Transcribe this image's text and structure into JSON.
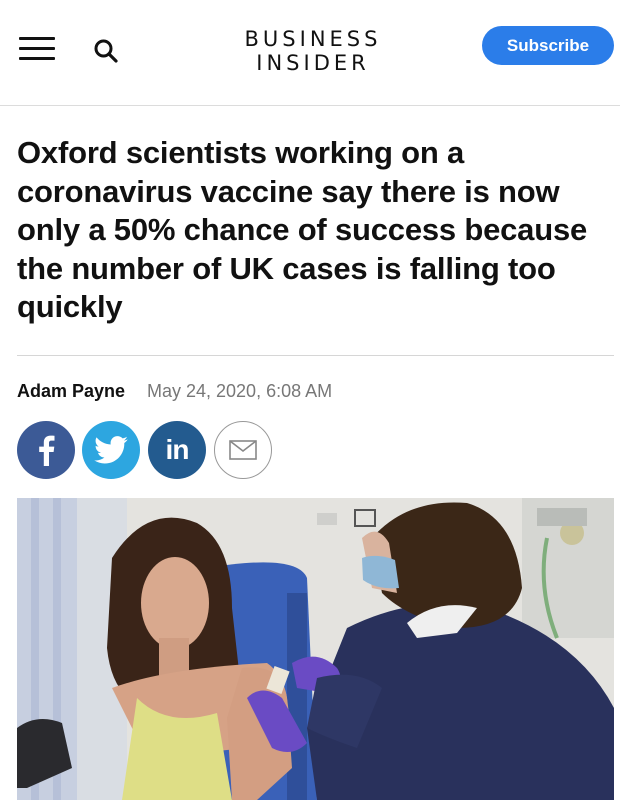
{
  "header": {
    "logo_line1": "BUSINESS",
    "logo_line2": "INSIDER",
    "subscribe_label": "Subscribe",
    "accent_color": "#2b7de9"
  },
  "icons": {
    "menu": "hamburger-menu-icon",
    "search": "search-icon",
    "facebook": "facebook-icon",
    "twitter": "twitter-icon",
    "linkedin": "linkedin-icon",
    "email": "email-icon"
  },
  "article": {
    "headline": "Oxford scientists working on a coronavirus vaccine say there is now only a 50% chance of success because the number of UK cases is falling too quickly",
    "author": "Adam Payne",
    "date": "May 24, 2020, 6:08 AM"
  },
  "share_colors": {
    "facebook": "#3c5a96",
    "twitter": "#2da6e0",
    "linkedin": "#235b8f"
  }
}
